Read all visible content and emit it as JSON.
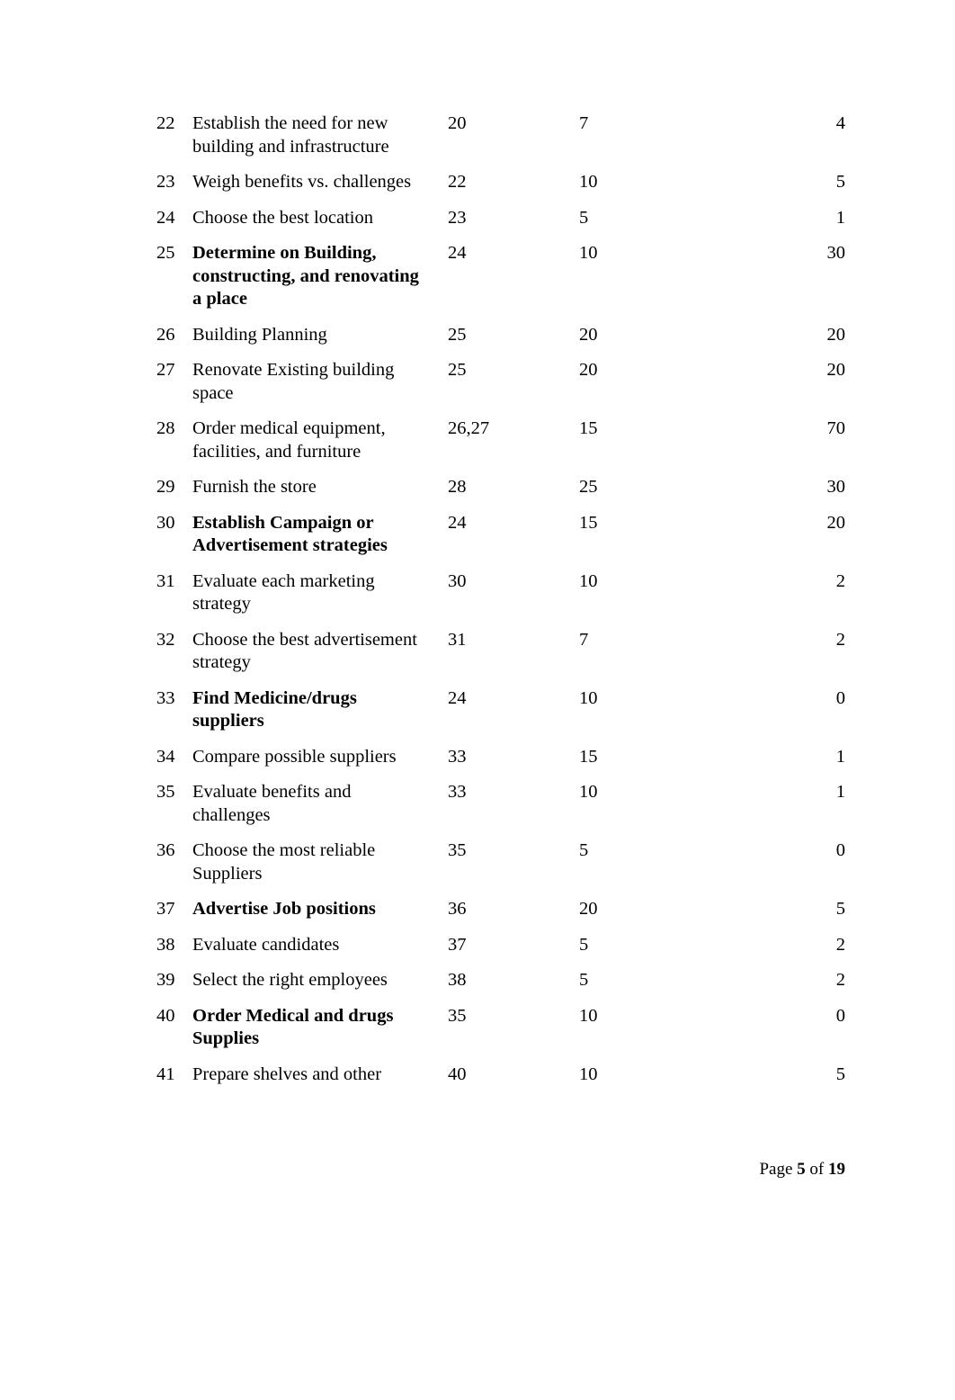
{
  "document": {
    "page_label_prefix": "Page",
    "page_label_middle": "of",
    "page_number": "5",
    "page_total": "19"
  },
  "table": {
    "rows": [
      {
        "id": "22",
        "task": "Establish the need for new building and infrastructure",
        "predecessor": "20",
        "duration": "7",
        "cost": "4",
        "bold": false
      },
      {
        "id": "23",
        "task": "Weigh benefits vs. challenges",
        "predecessor": "22",
        "duration": "10",
        "cost": "5",
        "bold": false
      },
      {
        "id": "24",
        "task": "Choose the best location",
        "predecessor": "23",
        "duration": "5",
        "cost": "1",
        "bold": false
      },
      {
        "id": "25",
        "task": "Determine on Building, constructing, and renovating a place",
        "predecessor": "24",
        "duration": "10",
        "cost": "30",
        "bold": true
      },
      {
        "id": "26",
        "task": "Building Planning",
        "predecessor": "25",
        "duration": "20",
        "cost": "20",
        "bold": false
      },
      {
        "id": "27",
        "task": "Renovate Existing building space",
        "predecessor": "25",
        "duration": "20",
        "cost": "20",
        "bold": false
      },
      {
        "id": "28",
        "task": "Order medical equipment, facilities, and furniture",
        "predecessor": "26,27",
        "duration": "15",
        "cost": "70",
        "bold": false
      },
      {
        "id": "29",
        "task": "Furnish the store",
        "predecessor": "28",
        "duration": "25",
        "cost": "30",
        "bold": false
      },
      {
        "id": "30",
        "task": "Establish Campaign or Advertisement strategies",
        "predecessor": "24",
        "duration": "15",
        "cost": "20",
        "bold": true
      },
      {
        "id": "31",
        "task": "Evaluate each marketing strategy",
        "predecessor": "30",
        "duration": "10",
        "cost": "2",
        "bold": false
      },
      {
        "id": "32",
        "task": "Choose the best advertisement strategy",
        "predecessor": "31",
        "duration": "7",
        "cost": "2",
        "bold": false
      },
      {
        "id": "33",
        "task": "Find Medicine/drugs suppliers",
        "predecessor": "24",
        "duration": "10",
        "cost": "0",
        "bold": true
      },
      {
        "id": "34",
        "task": "Compare possible suppliers",
        "predecessor": "33",
        "duration": "15",
        "cost": "1",
        "bold": false
      },
      {
        "id": "35",
        "task": "Evaluate benefits and challenges",
        "predecessor": "33",
        "duration": "10",
        "cost": "1",
        "bold": false
      },
      {
        "id": "36",
        "task": "Choose the most reliable Suppliers",
        "predecessor": "35",
        "duration": "5",
        "cost": "0",
        "bold": false
      },
      {
        "id": "37",
        "task": "Advertise Job positions",
        "predecessor": "36",
        "duration": "20",
        "cost": "5",
        "bold": true
      },
      {
        "id": "38",
        "task": "Evaluate candidates",
        "predecessor": "37",
        "duration": "5",
        "cost": "2",
        "bold": false
      },
      {
        "id": "39",
        "task": "Select the right employees",
        "predecessor": "38",
        "duration": "5",
        "cost": "2",
        "bold": false
      },
      {
        "id": "40",
        "task": "Order Medical and drugs Supplies",
        "predecessor": "35",
        "duration": "10",
        "cost": "0",
        "bold": true
      },
      {
        "id": "41",
        "task": "Prepare shelves and other",
        "predecessor": "40",
        "duration": "10",
        "cost": "5",
        "bold": false
      }
    ]
  }
}
